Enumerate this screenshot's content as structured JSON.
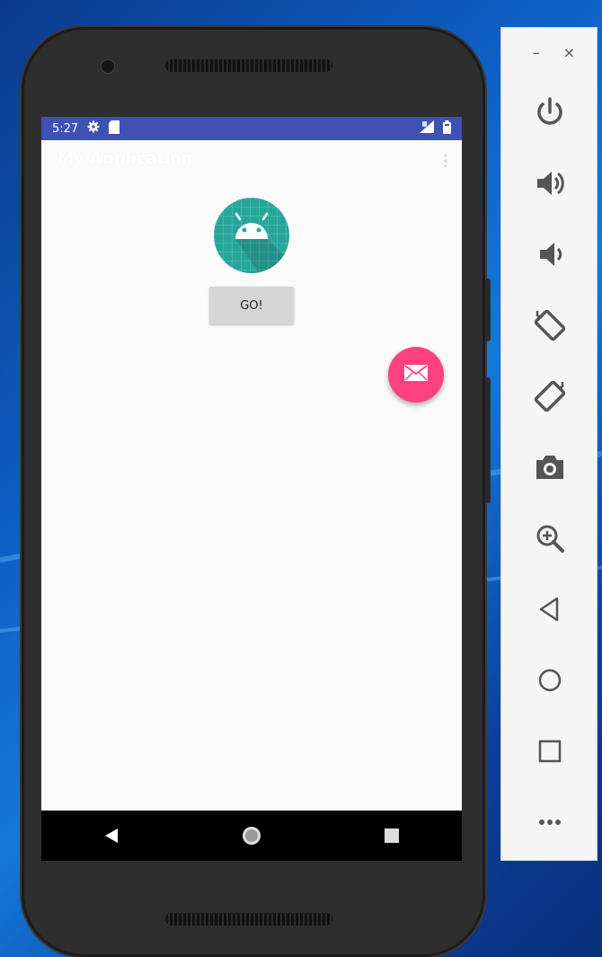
{
  "status_bar": {
    "time": "5:27"
  },
  "app": {
    "title": "My Application",
    "go_button_label": "GO!"
  },
  "emulator_toolbar": {
    "window_controls": {
      "minimize": "–",
      "close": "×"
    },
    "buttons": [
      "power-icon",
      "volume-up-icon",
      "volume-down-icon",
      "rotate-left-icon",
      "rotate-right-icon",
      "camera-icon",
      "zoom-icon",
      "back-icon",
      "home-icon",
      "overview-icon",
      "more-icon"
    ]
  },
  "colors": {
    "status_bar": "#3f51b5",
    "fab": "#ff4081",
    "logo": "#26a69a",
    "toolbar_icons": "#555555"
  }
}
